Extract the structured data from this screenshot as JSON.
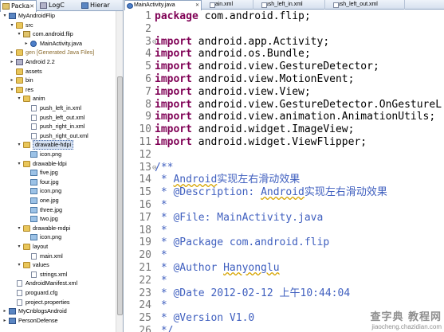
{
  "left_tabs": [
    "Packa",
    "LogC",
    "Hierar"
  ],
  "tree": [
    {
      "label": "MyAndroidFlip",
      "indent": 0,
      "icon": "project",
      "toggle": "▾"
    },
    {
      "label": "src",
      "indent": 1,
      "icon": "folder",
      "toggle": "▾"
    },
    {
      "label": "com.android.flip",
      "indent": 2,
      "icon": "package",
      "toggle": "▾"
    },
    {
      "label": "MainActivity.java",
      "indent": 3,
      "icon": "java",
      "toggle": "▸"
    },
    {
      "label": "gen [Generated Java Files]",
      "indent": 1,
      "icon": "folder",
      "toggle": "▸",
      "gen": true
    },
    {
      "label": "Android 2.2",
      "indent": 1,
      "icon": "library",
      "toggle": "▸"
    },
    {
      "label": "assets",
      "indent": 1,
      "icon": "folder",
      "toggle": ""
    },
    {
      "label": "bin",
      "indent": 1,
      "icon": "folder",
      "toggle": "▸"
    },
    {
      "label": "res",
      "indent": 1,
      "icon": "folder",
      "toggle": "▾"
    },
    {
      "label": "anim",
      "indent": 2,
      "icon": "folder",
      "toggle": "▾"
    },
    {
      "label": "push_left_in.xml",
      "indent": 3,
      "icon": "file",
      "toggle": ""
    },
    {
      "label": "push_left_out.xml",
      "indent": 3,
      "icon": "file",
      "toggle": ""
    },
    {
      "label": "push_right_in.xml",
      "indent": 3,
      "icon": "file",
      "toggle": ""
    },
    {
      "label": "push_right_out.xml",
      "indent": 3,
      "icon": "file",
      "toggle": ""
    },
    {
      "label": "drawable-hdpi",
      "indent": 2,
      "icon": "folder",
      "toggle": "▾",
      "selected": true
    },
    {
      "label": "icon.png",
      "indent": 3,
      "icon": "image",
      "toggle": ""
    },
    {
      "label": "drawable-ldpi",
      "indent": 2,
      "icon": "folder",
      "toggle": "▾"
    },
    {
      "label": "five.jpg",
      "indent": 3,
      "icon": "image",
      "toggle": ""
    },
    {
      "label": "four.jpg",
      "indent": 3,
      "icon": "image",
      "toggle": ""
    },
    {
      "label": "icon.png",
      "indent": 3,
      "icon": "image",
      "toggle": ""
    },
    {
      "label": "one.jpg",
      "indent": 3,
      "icon": "image",
      "toggle": ""
    },
    {
      "label": "three.jpg",
      "indent": 3,
      "icon": "image",
      "toggle": ""
    },
    {
      "label": "two.jpg",
      "indent": 3,
      "icon": "image",
      "toggle": ""
    },
    {
      "label": "drawable-mdpi",
      "indent": 2,
      "icon": "folder",
      "toggle": "▾"
    },
    {
      "label": "icon.png",
      "indent": 3,
      "icon": "image",
      "toggle": ""
    },
    {
      "label": "layout",
      "indent": 2,
      "icon": "folder",
      "toggle": "▾"
    },
    {
      "label": "main.xml",
      "indent": 3,
      "icon": "file",
      "toggle": ""
    },
    {
      "label": "values",
      "indent": 2,
      "icon": "folder",
      "toggle": "▾"
    },
    {
      "label": "strings.xml",
      "indent": 3,
      "icon": "file",
      "toggle": ""
    },
    {
      "label": "AndroidManifest.xml",
      "indent": 1,
      "icon": "file",
      "toggle": ""
    },
    {
      "label": "proguard.cfg",
      "indent": 1,
      "icon": "file",
      "toggle": ""
    },
    {
      "label": "project.properties",
      "indent": 1,
      "icon": "file",
      "toggle": ""
    },
    {
      "label": "MyCnblogsAndroid",
      "indent": 0,
      "icon": "project",
      "toggle": "▸"
    },
    {
      "label": "PersonDefense",
      "indent": 0,
      "icon": "project",
      "toggle": "▸"
    }
  ],
  "editor_tabs": [
    "MainActivity.java",
    "main.xml",
    "push_left_in.xml",
    "push_left_out.xml"
  ],
  "code": [
    {
      "n": "1",
      "fold": "",
      "segs": [
        {
          "c": "kw",
          "t": "package"
        },
        {
          "c": "",
          "t": " com.android.flip;"
        }
      ]
    },
    {
      "n": "2",
      "fold": "",
      "segs": []
    },
    {
      "n": "3",
      "fold": "⊖",
      "segs": [
        {
          "c": "kw",
          "t": "import"
        },
        {
          "c": "",
          "t": " android.app.Activity;"
        }
      ]
    },
    {
      "n": "4",
      "fold": "",
      "segs": [
        {
          "c": "kw",
          "t": "import"
        },
        {
          "c": "",
          "t": " android.os.Bundle;"
        }
      ]
    },
    {
      "n": "5",
      "fold": "",
      "segs": [
        {
          "c": "kw",
          "t": "import"
        },
        {
          "c": "",
          "t": " android.view.GestureDetector;"
        }
      ]
    },
    {
      "n": "6",
      "fold": "",
      "segs": [
        {
          "c": "kw",
          "t": "import"
        },
        {
          "c": "",
          "t": " android.view.MotionEvent;"
        }
      ]
    },
    {
      "n": "7",
      "fold": "",
      "segs": [
        {
          "c": "kw",
          "t": "import"
        },
        {
          "c": "",
          "t": " android.view.View;"
        }
      ]
    },
    {
      "n": "8",
      "fold": "",
      "segs": [
        {
          "c": "kw",
          "t": "import"
        },
        {
          "c": "",
          "t": " android.view.GestureDetector.OnGestureL"
        }
      ]
    },
    {
      "n": "9",
      "fold": "",
      "segs": [
        {
          "c": "kw",
          "t": "import"
        },
        {
          "c": "",
          "t": " android.view.animation.AnimationUtils;"
        }
      ]
    },
    {
      "n": "10",
      "fold": "",
      "segs": [
        {
          "c": "kw",
          "t": "import"
        },
        {
          "c": "",
          "t": " android.widget.ImageView;"
        }
      ]
    },
    {
      "n": "11",
      "fold": "",
      "segs": [
        {
          "c": "kw",
          "t": "import"
        },
        {
          "c": "",
          "t": " android.widget.ViewFlipper;"
        }
      ]
    },
    {
      "n": "12",
      "fold": "",
      "segs": []
    },
    {
      "n": "13",
      "fold": "⊖",
      "segs": [
        {
          "c": "jd",
          "t": "/**"
        }
      ]
    },
    {
      "n": "14",
      "fold": "",
      "segs": [
        {
          "c": "jd",
          "t": " * "
        },
        {
          "c": "jd sq",
          "t": "Android"
        },
        {
          "c": "jd",
          "t": "实现左右滑动效果"
        }
      ]
    },
    {
      "n": "15",
      "fold": "",
      "segs": [
        {
          "c": "jd",
          "t": " * @Description: "
        },
        {
          "c": "jd sq",
          "t": "Android"
        },
        {
          "c": "jd",
          "t": "实现左右滑动效果"
        }
      ]
    },
    {
      "n": "16",
      "fold": "",
      "segs": [
        {
          "c": "jd",
          "t": " *"
        }
      ]
    },
    {
      "n": "17",
      "fold": "",
      "segs": [
        {
          "c": "jd",
          "t": " * @File: MainActivity.java"
        }
      ]
    },
    {
      "n": "18",
      "fold": "",
      "segs": [
        {
          "c": "jd",
          "t": " *"
        }
      ]
    },
    {
      "n": "19",
      "fold": "",
      "segs": [
        {
          "c": "jd",
          "t": " * @Package com.android.flip"
        }
      ]
    },
    {
      "n": "20",
      "fold": "",
      "segs": [
        {
          "c": "jd",
          "t": " *"
        }
      ]
    },
    {
      "n": "21",
      "fold": "",
      "segs": [
        {
          "c": "jd",
          "t": " * @Author "
        },
        {
          "c": "jd sq",
          "t": "Hanyonglu"
        }
      ]
    },
    {
      "n": "22",
      "fold": "",
      "segs": [
        {
          "c": "jd",
          "t": " *"
        }
      ]
    },
    {
      "n": "23",
      "fold": "",
      "segs": [
        {
          "c": "jd",
          "t": " * @Date 2012-02-12 上午10:44:04"
        }
      ]
    },
    {
      "n": "24",
      "fold": "",
      "segs": [
        {
          "c": "jd",
          "t": " *"
        }
      ]
    },
    {
      "n": "25",
      "fold": "",
      "segs": [
        {
          "c": "jd",
          "t": " * @Version V1.0"
        }
      ]
    },
    {
      "n": "26",
      "fold": "",
      "segs": [
        {
          "c": "jd",
          "t": " */"
        }
      ]
    }
  ],
  "watermark": {
    "line1": "查字典 教程网",
    "line2": "jiaocheng.chazidian.com"
  },
  "colors": {
    "keyword": "#7f0055",
    "javadoc": "#3f5fbf",
    "line_number": "#787878",
    "selection": "#d4e0f2"
  }
}
